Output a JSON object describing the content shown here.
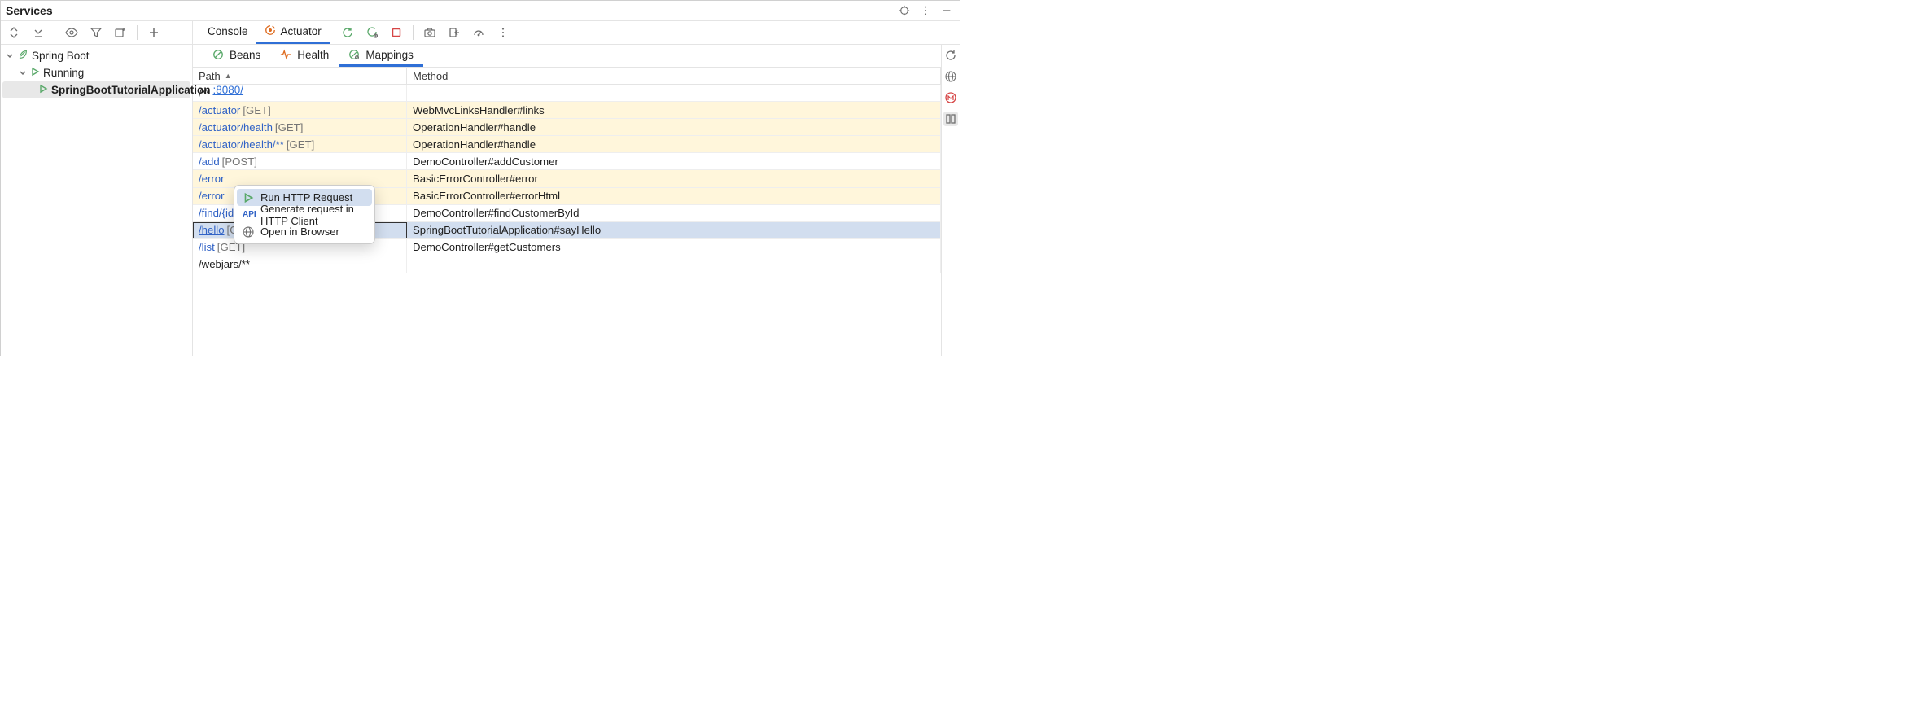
{
  "title": "Services",
  "mainTabs": {
    "console": "Console",
    "actuator": "Actuator"
  },
  "tree": {
    "root": "Spring Boot",
    "running": "Running",
    "app": "SpringBootTutorialApplication",
    "port": ":8080/"
  },
  "subtabs": {
    "beans": "Beans",
    "health": "Health",
    "mappings": "Mappings"
  },
  "columns": {
    "path": "Path",
    "method": "Method"
  },
  "rows": {
    "r0": {
      "path_text": "/**",
      "method": ""
    },
    "r1": {
      "path": "/actuator",
      "verb": "[GET]",
      "method": "WebMvcLinksHandler#links"
    },
    "r2": {
      "path": "/actuator/health",
      "verb": "[GET]",
      "method": "OperationHandler#handle"
    },
    "r3": {
      "path": "/actuator/health/**",
      "verb": "[GET]",
      "method": "OperationHandler#handle"
    },
    "r4": {
      "path": "/add",
      "verb": "[POST]",
      "method": "DemoController#addCustomer"
    },
    "r5": {
      "path": "/error",
      "verb": "",
      "method": "BasicErrorController#error"
    },
    "r6": {
      "path": "/error",
      "verb": "",
      "method": "BasicErrorController#errorHtml"
    },
    "r7": {
      "path": "/find/{id}",
      "verb": "[GET]",
      "method": "DemoController#findCustomerById"
    },
    "r8": {
      "path": "/hello",
      "verb": "[GET]",
      "method": "SpringBootTutorialApplication#sayHello"
    },
    "r9": {
      "path": "/list",
      "verb": "[GET]",
      "method": "DemoController#getCustomers"
    },
    "r10": {
      "path_text": "/webjars/**",
      "method": ""
    }
  },
  "contextMenu": {
    "run": "Run HTTP Request",
    "generate": "Generate request in HTTP Client",
    "open": "Open in Browser"
  }
}
